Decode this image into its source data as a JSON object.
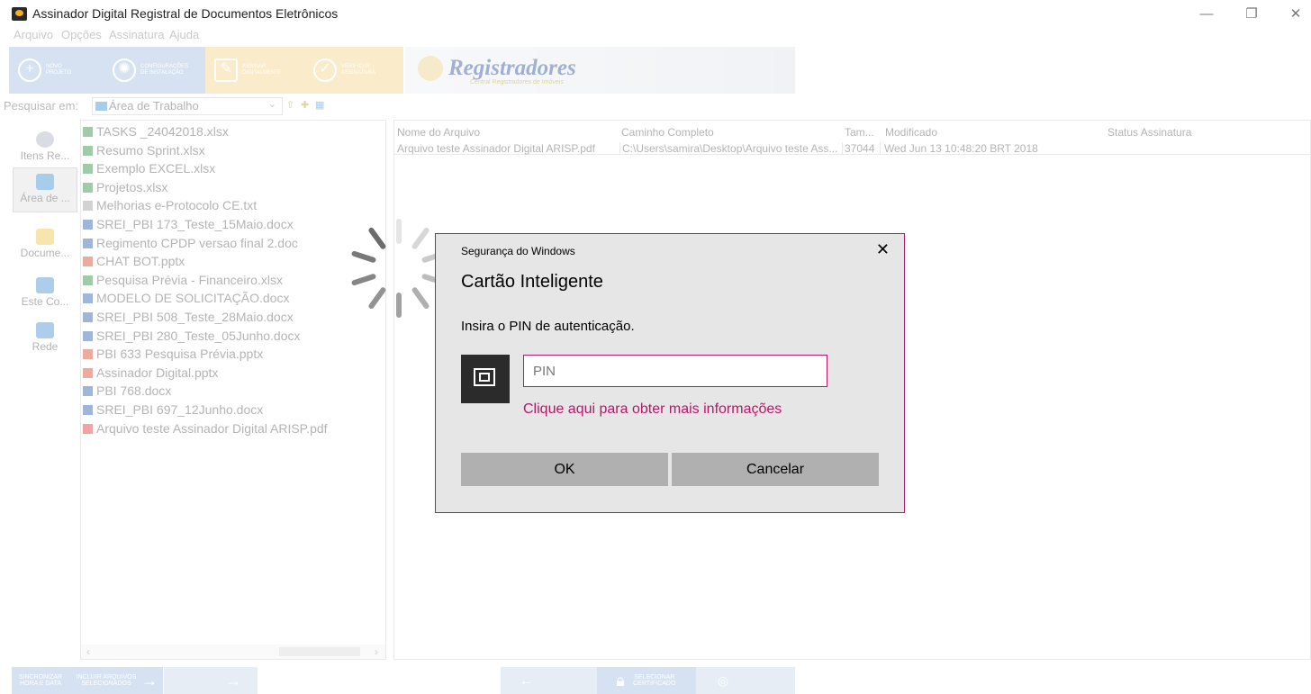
{
  "window": {
    "title": "Assinador Digital Registral de Documentos Eletrônicos",
    "controls": [
      "—",
      "❐",
      "✕"
    ]
  },
  "menu": [
    "Arquivo",
    "Opções",
    "Assinatura",
    "Ajuda"
  ],
  "toolbar": {
    "buttons": [
      {
        "label": "NOVO PROJETO",
        "color": "#a3bfe0"
      },
      {
        "label": "CONFIGURAÇÕES DE INSTALAÇÃO",
        "color": "#a3bfe0"
      },
      {
        "label": "ASSINAR DIGITALMENTE",
        "color": "#f3d28a"
      },
      {
        "label": "VERIFICAR ASSINATURA",
        "color": "#f3d28a"
      }
    ],
    "logo": {
      "name": "Registradores",
      "subtitle": "Central Registradores de Imóveis"
    }
  },
  "search": {
    "label": "Pesquisar em:",
    "location": "Área de Trabalho"
  },
  "places": [
    {
      "label": "Itens Re...",
      "icon": "recent-items-icon",
      "color": "#aab4c0"
    },
    {
      "label": "Área de ...",
      "icon": "desktop-icon",
      "color": "#3c8fd6"
    },
    {
      "label": "Docume...",
      "icon": "documents-icon",
      "color": "#f0c64a"
    },
    {
      "label": "Este Co...",
      "icon": "computer-icon",
      "color": "#4a8fd0"
    },
    {
      "label": "Rede",
      "icon": "network-icon",
      "color": "#4a8fd0"
    }
  ],
  "files": [
    {
      "name": "TASKS _24042018.xlsx",
      "color": "#2e8b3e"
    },
    {
      "name": "Resumo Sprint.xlsx",
      "color": "#2e8b3e"
    },
    {
      "name": "Exemplo EXCEL.xlsx",
      "color": "#2e8b3e"
    },
    {
      "name": "Projetos.xlsx",
      "color": "#2e8b3e"
    },
    {
      "name": "Melhorias e-Protocolo CE.txt",
      "color": "#9a9a9a"
    },
    {
      "name": "SREI_PBI 173_Teste_15Maio.docx",
      "color": "#2b5ca8"
    },
    {
      "name": "Regimento CPDP versao final 2.doc",
      "color": "#2b5ca8"
    },
    {
      "name": "CHAT BOT.pptx",
      "color": "#d24726"
    },
    {
      "name": "Pesquisa Prévia - Financeiro.xlsx",
      "color": "#2e8b3e"
    },
    {
      "name": "MODELO DE SOLICITAÇÃO.docx",
      "color": "#2b5ca8"
    },
    {
      "name": "SREI_PBI 508_Teste_28Maio.docx",
      "color": "#2b5ca8"
    },
    {
      "name": "SREI_PBI 280_Teste_05Junho.docx",
      "color": "#2b5ca8"
    },
    {
      "name": "PBI 633 Pesquisa Prévia.pptx",
      "color": "#d24726"
    },
    {
      "name": "Assinador Digital.pptx",
      "color": "#d24726"
    },
    {
      "name": "PBI 768.docx",
      "color": "#2b5ca8"
    },
    {
      "name": "SREI_PBI 697_12Junho.docx",
      "color": "#2b5ca8"
    },
    {
      "name": "Arquivo teste Assinador Digital ARISP.pdf",
      "color": "#e03030"
    }
  ],
  "table": {
    "columns": [
      "Nome do Arquivo",
      "Caminho Completo",
      "Tam...",
      "Modificado",
      "Status Assinatura"
    ],
    "rows": [
      [
        "Arquivo teste Assinador Digital ARISP.pdf",
        "C:\\Users\\samira\\Desktop\\Arquivo teste Ass...",
        "37044",
        "Wed Jun 13 10:48:20 BRT 2018",
        ""
      ]
    ]
  },
  "bottom": {
    "buttons": [
      {
        "label": "SINCRONIZAR HORA E DATA",
        "color": "#a3bfe0"
      },
      {
        "label": "INCLUIR ARQUIVOS SELECIONADOS",
        "color": "#a3bfe0"
      },
      {
        "label": "",
        "color": "#c8d6e8"
      },
      {
        "label": "",
        "color": "#c8d6e8"
      },
      {
        "label": "SELECIONAR CERTIFICADO",
        "color": "#a3bfe0"
      },
      {
        "label": "",
        "color": "#c8d6e8"
      }
    ]
  },
  "dialog": {
    "caption": "Segurança do Windows",
    "heading": "Cartão Inteligente",
    "prompt": "Insira o PIN de autenticação.",
    "pin_placeholder": "PIN",
    "pin_value": "",
    "more_info": "Clique aqui para obter mais informações",
    "ok": "OK",
    "cancel": "Cancelar",
    "accent": "#b4186a"
  }
}
